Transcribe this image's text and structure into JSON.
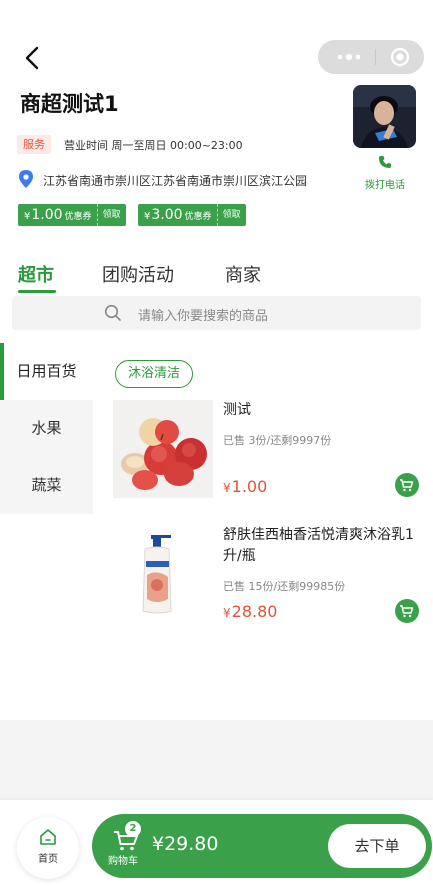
{
  "store": {
    "name": "商超测试1",
    "service_tag": "服务",
    "hours": "营业时间 周一至周日 00:00~23:00",
    "address": "江苏省南通市崇川区江苏省南通市崇川区滨江公园",
    "call_label": "拨打电话"
  },
  "coupons": [
    {
      "currency": "¥",
      "amount": "1.00",
      "label": "优惠券",
      "action": "领取"
    },
    {
      "currency": "¥",
      "amount": "3.00",
      "label": "优惠券",
      "action": "领取"
    }
  ],
  "tabs": [
    "超市",
    "团购活动",
    "商家"
  ],
  "search": {
    "placeholder": "请输入你要搜索的商品"
  },
  "categories": [
    "日用百货",
    "水果",
    "蔬菜"
  ],
  "subcategory": "沐浴清洁",
  "products": [
    {
      "name": "测试",
      "sales": "已售 3份/还剩9997份",
      "currency": "¥",
      "price": "1.00"
    },
    {
      "name": "舒肤佳西柚香活悦清爽沐浴乳1升/瓶",
      "sales": "已售 15份/还剩99985份",
      "currency": "¥",
      "price": "28.80"
    }
  ],
  "bottom": {
    "home_label": "首页",
    "cart_label": "购物车",
    "cart_count": "2",
    "total": "¥29.80",
    "checkout_label": "去下单"
  },
  "colors": {
    "accent": "#2b9a3c",
    "price": "#e0553a",
    "service_tag_bg": "#fde9e5"
  }
}
